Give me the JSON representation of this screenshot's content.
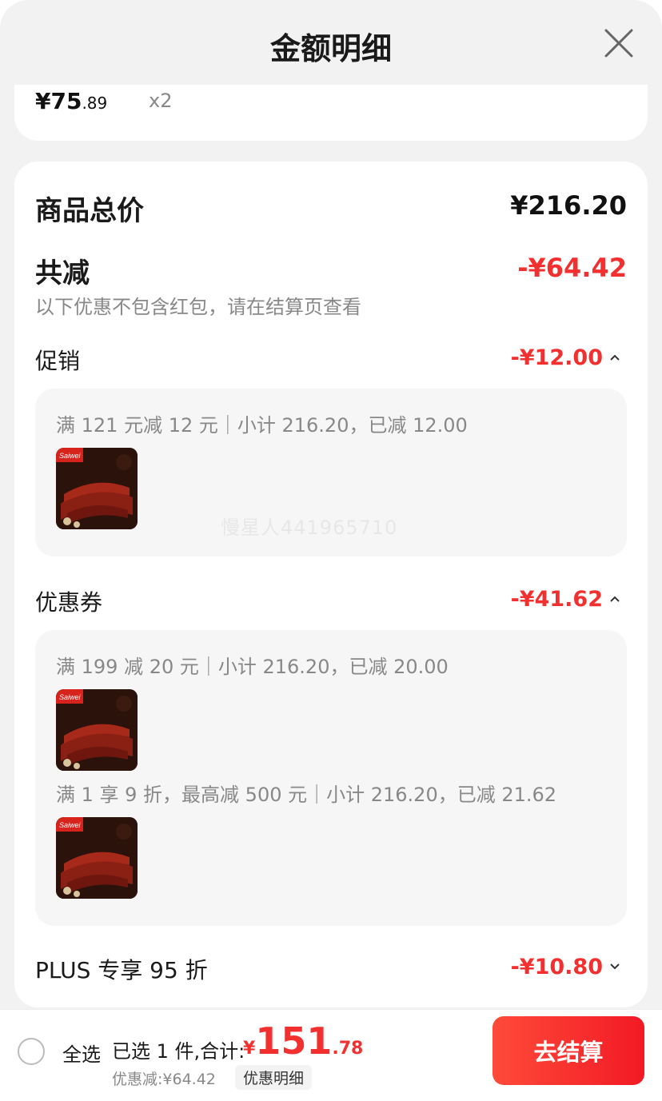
{
  "header": {
    "title": "金额明细",
    "close_icon": "close-icon"
  },
  "item": {
    "price_int": "¥75",
    "price_dec": ".89",
    "qty": "x2"
  },
  "summary": {
    "total_label": "商品总价",
    "total_value": "¥216.20",
    "reduce_label": "共减",
    "reduce_value": "-¥64.42",
    "note": "以下优惠不包含红包，请在结算页查看"
  },
  "promo": {
    "label": "促销",
    "value": "-¥12.00",
    "line": "满 121 元减 12 元｜小计 216.20，已减 12.00"
  },
  "coupon": {
    "label": "优惠券",
    "value": "-¥41.62",
    "line1": "满 199 减 20 元｜小计 216.20，已减 20.00",
    "line2": "满 1 享 9 折，最高减 500 元｜小计 216.20，已减 21.62"
  },
  "plus": {
    "label": "PLUS 专享 95 折",
    "value": "-¥10.80"
  },
  "watermark": "慢星人441965710",
  "footer": {
    "select_all": "全选",
    "selected_text": "已选 1 件,合计:",
    "total_currency": "¥",
    "total_int": "151",
    "total_dec": ".78",
    "discount_text": "优惠减:¥64.42",
    "detail_button": "优惠明细",
    "checkout_button": "去结算"
  },
  "colors": {
    "accent": "#f23030",
    "muted": "#888888",
    "sheet_bg": "#f2f2f2",
    "box_bg": "#f6f6f6"
  }
}
